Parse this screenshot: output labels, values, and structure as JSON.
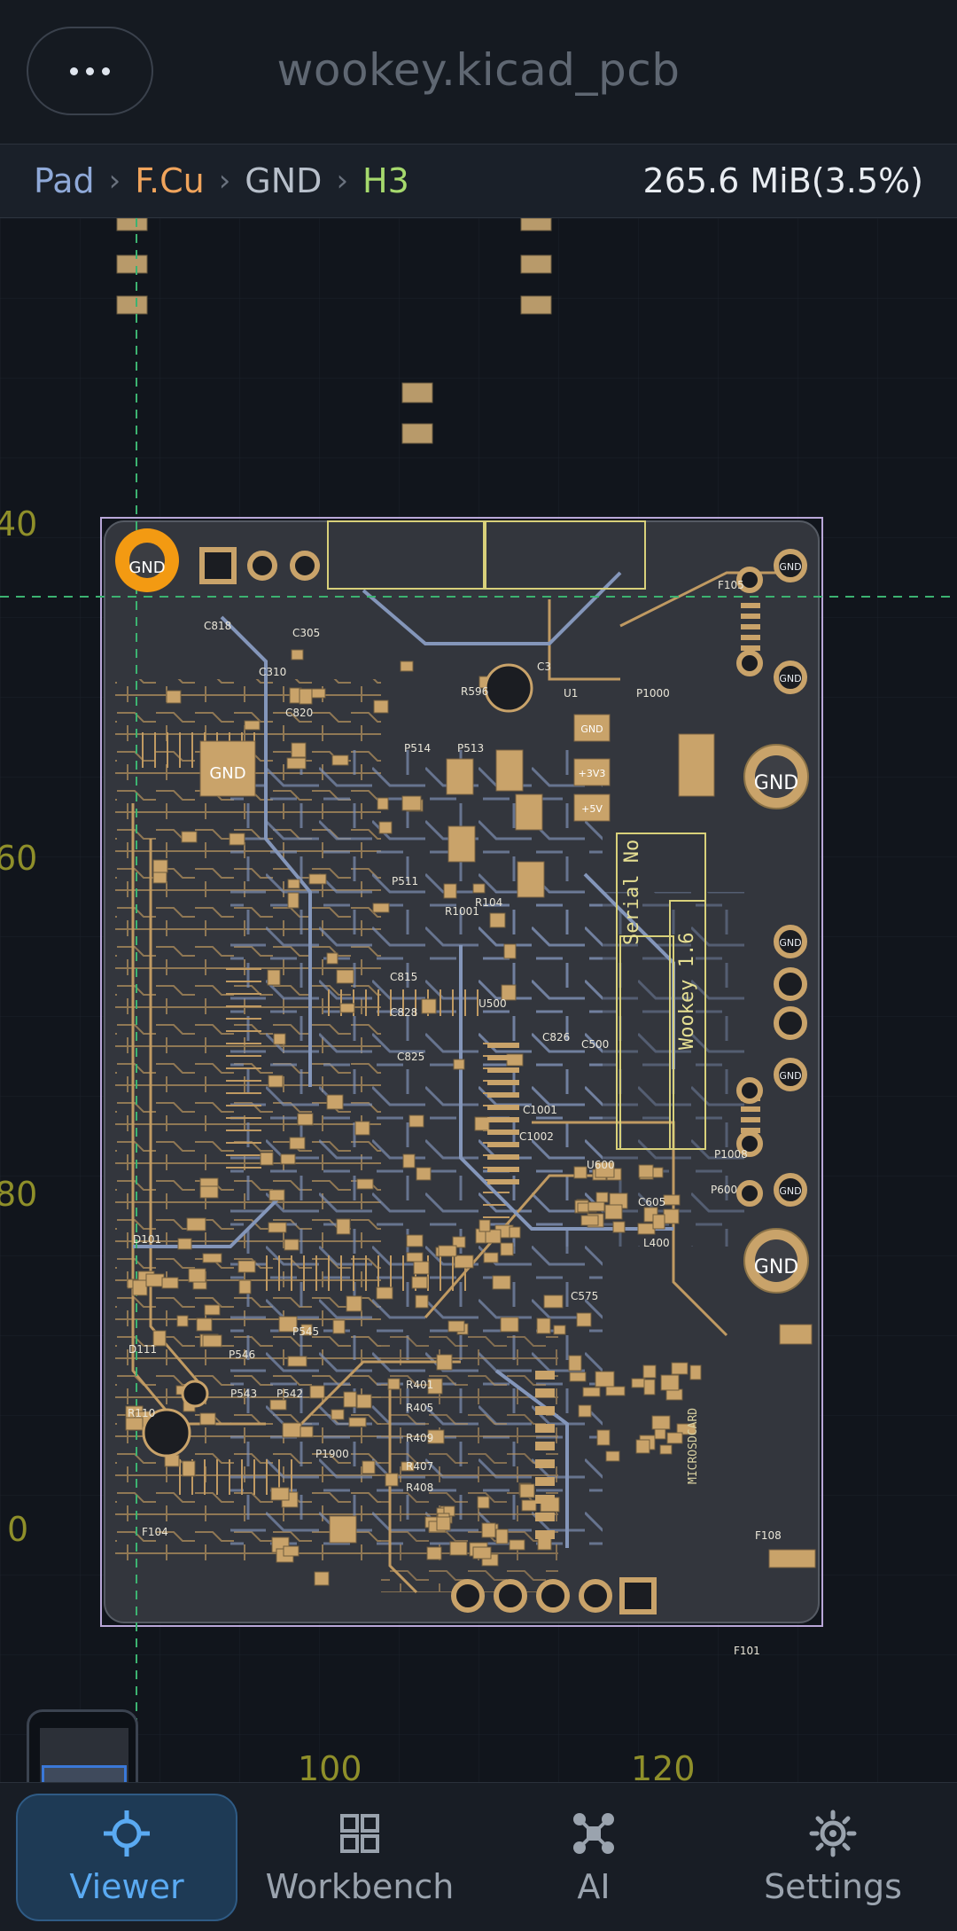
{
  "app": {
    "title": "wookey.kicad_pcb"
  },
  "breadcrumb": {
    "items": [
      "Pad",
      "F.Cu",
      "GND",
      "H3"
    ],
    "separator": "›",
    "memory": "265.6 MiB(3.5%)"
  },
  "viewer": {
    "axis_y_labels": [
      "40",
      "60",
      "80",
      "0"
    ],
    "axis_x_labels": [
      "100",
      "120"
    ],
    "board_texts": {
      "serial": "Serial No",
      "version": "Wookey 1.6",
      "microsd": "MICROSDCARD",
      "gnd": "GND",
      "plus3v3": "+3V3",
      "plus5v": "+5V",
      "refs": [
        "C305",
        "C310",
        "C818",
        "C820",
        "C825",
        "C826",
        "C815",
        "C828",
        "C500",
        "C1001",
        "C1002",
        "C605",
        "C575",
        "U500",
        "U600",
        "R1001",
        "R104",
        "R401",
        "R405",
        "R407",
        "R408",
        "R409",
        "R110",
        "R596",
        "P514",
        "P513",
        "P511",
        "P546",
        "P543",
        "P542",
        "P545",
        "P1900",
        "P1000",
        "P1008",
        "F104",
        "F108",
        "F101",
        "F105",
        "D101",
        "D111",
        "L400",
        "P600",
        "U1",
        "C3"
      ]
    }
  },
  "bottom_nav": {
    "items": [
      {
        "label": "Viewer",
        "icon": "crosshair-icon",
        "active": true
      },
      {
        "label": "Workbench",
        "icon": "grid-icon",
        "active": false
      },
      {
        "label": "AI",
        "icon": "network-icon",
        "active": false
      },
      {
        "label": "Settings",
        "icon": "gear-icon",
        "active": false
      }
    ]
  },
  "colors": {
    "copper": "#c9a36a",
    "trace_blue": "#8090b0",
    "board": "#33363d",
    "accent": "#5aaaf2",
    "selected_pad": "#f39a12",
    "axis": "#8f8f2a",
    "cursor": "#3cb371"
  }
}
